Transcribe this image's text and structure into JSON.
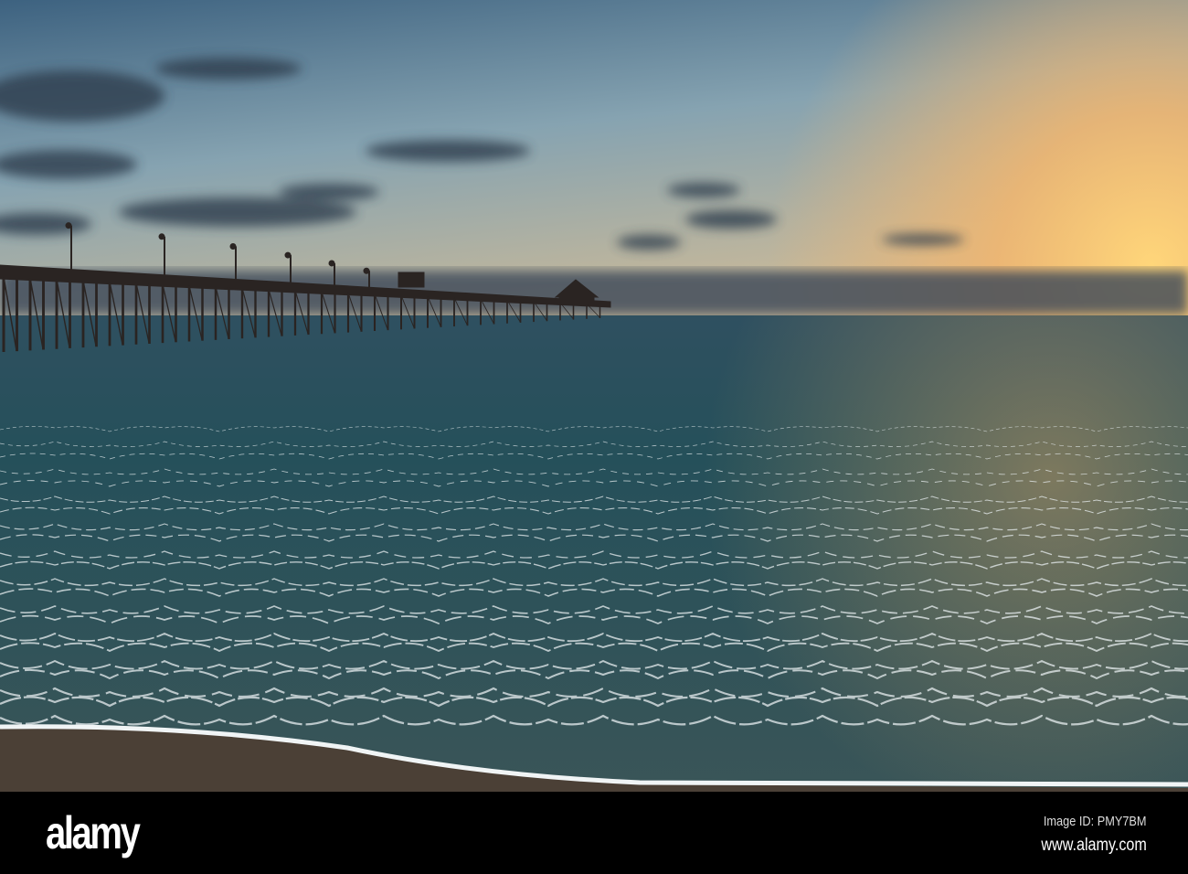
{
  "watermark": {
    "logo": "alamy",
    "image_id": "Image ID: PMY7BM",
    "url": "www.alamy.com"
  },
  "colors": {
    "sky_top": "#3f6584",
    "sky_glow": "#f5c06a",
    "water": "#22434f",
    "sand": "#4a3f33",
    "footer": "#000000"
  }
}
